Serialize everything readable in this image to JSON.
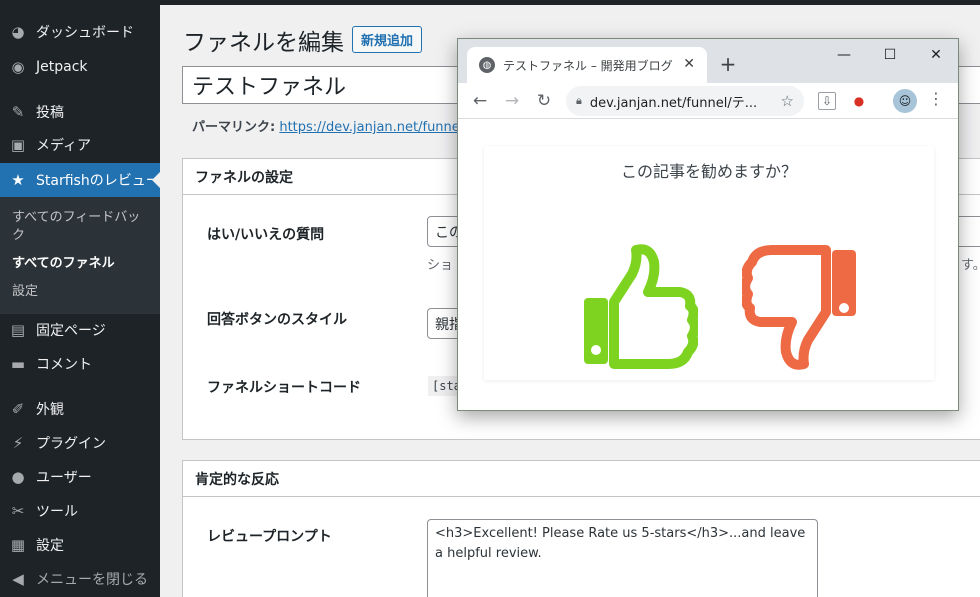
{
  "sidebar": {
    "items": [
      {
        "label": "ダッシュボード",
        "icon": "dashboard-icon"
      },
      {
        "label": "Jetpack",
        "icon": "jetpack-icon"
      },
      {
        "label": "投稿",
        "icon": "pin-icon"
      },
      {
        "label": "メディア",
        "icon": "media-icon"
      },
      {
        "label": "Starfishのレビュー",
        "icon": "star-icon",
        "active": true
      },
      {
        "label": "固定ページ",
        "icon": "page-icon"
      },
      {
        "label": "コメント",
        "icon": "comment-icon"
      },
      {
        "label": "外観",
        "icon": "brush-icon"
      },
      {
        "label": "プラグイン",
        "icon": "plugin-icon"
      },
      {
        "label": "ユーザー",
        "icon": "user-icon"
      },
      {
        "label": "ツール",
        "icon": "wrench-icon"
      },
      {
        "label": "設定",
        "icon": "settings-icon"
      },
      {
        "label": "メニューを閉じる",
        "icon": "collapse-icon"
      }
    ],
    "submenu": [
      "すべてのフィードバック",
      "すべてのファネル",
      "設定"
    ]
  },
  "page": {
    "title": "ファネルを編集",
    "add_new": "新規追加",
    "post_title": "テストファネル",
    "permalink_label": "パーマリンク:",
    "permalink_url": "https://dev.janjan.net/funnel/テ"
  },
  "funnel_settings": {
    "heading": "ファネルの設定",
    "q_label": "はい/いいえの質問",
    "q_value": "この",
    "q_desc": "ショ",
    "q_desc_tail": "す。",
    "style_label": "回答ボタンのスタイル",
    "style_value": "親指",
    "shortcode_label": "ファネルショートコード",
    "shortcode_value": "[sta"
  },
  "positive": {
    "heading": "肯定的な反応",
    "prompt_label": "レビュープロンプト",
    "prompt_value": "<h3>Excellent! Please Rate us 5-stars</h3>...and leave a helpful review."
  },
  "browser": {
    "tab_title": "テストファネル – 開発用ブログ",
    "url_host": "dev.janjan.net",
    "url_path": "/funnel/テ...",
    "question": "この記事を勧めますか？",
    "thumb_up_color": "#7ed321",
    "thumb_down_color": "#ee6a45"
  },
  "colors": {
    "sidebar_bg": "#1d2327",
    "accent": "#2271b1"
  }
}
